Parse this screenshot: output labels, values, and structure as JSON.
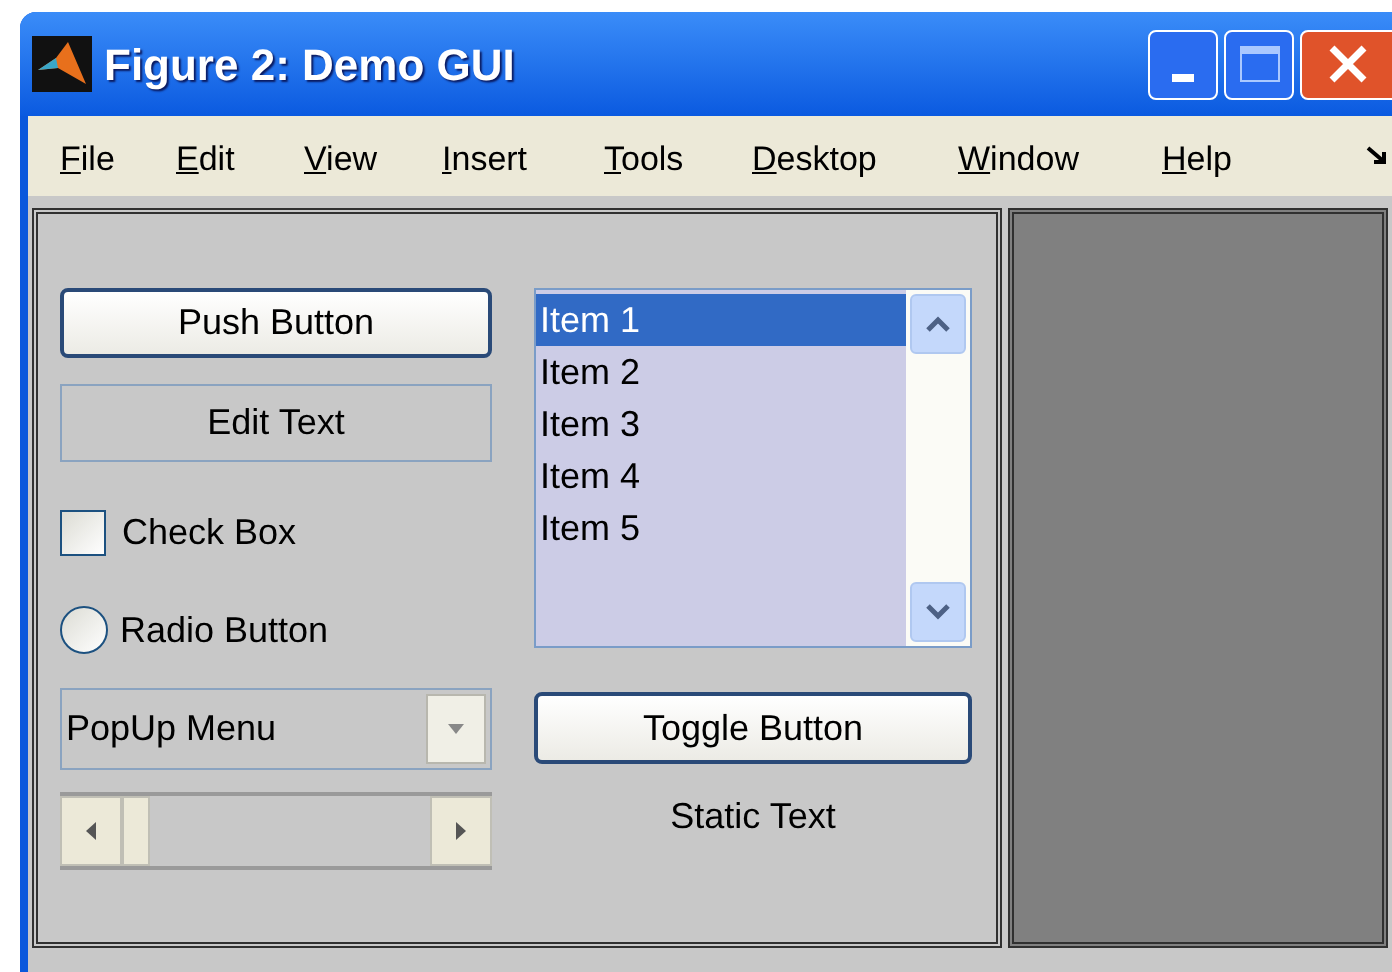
{
  "window": {
    "title": "Figure 2: Demo GUI"
  },
  "menu": [
    "File",
    "Edit",
    "View",
    "Insert",
    "Tools",
    "Desktop",
    "Window",
    "Help"
  ],
  "controls": {
    "push_button": "Push Button",
    "edit_text": "Edit Text",
    "check_box": {
      "label": "Check Box",
      "checked": false
    },
    "radio_button": {
      "label": "Radio Button",
      "selected": false
    },
    "popup_menu": {
      "value": "PopUp Menu"
    },
    "slider": {
      "level": 0
    },
    "list_box": {
      "items": [
        {
          "label": "Item 1",
          "selected": true
        },
        {
          "label": "Item 2",
          "selected": false
        },
        {
          "label": "Item 3",
          "selected": false
        },
        {
          "label": "Item 4",
          "selected": false
        },
        {
          "label": "Item 5",
          "selected": false
        }
      ]
    },
    "toggle_button": {
      "label": "Toggle Button",
      "on": false
    },
    "static_text": "Static Text"
  }
}
